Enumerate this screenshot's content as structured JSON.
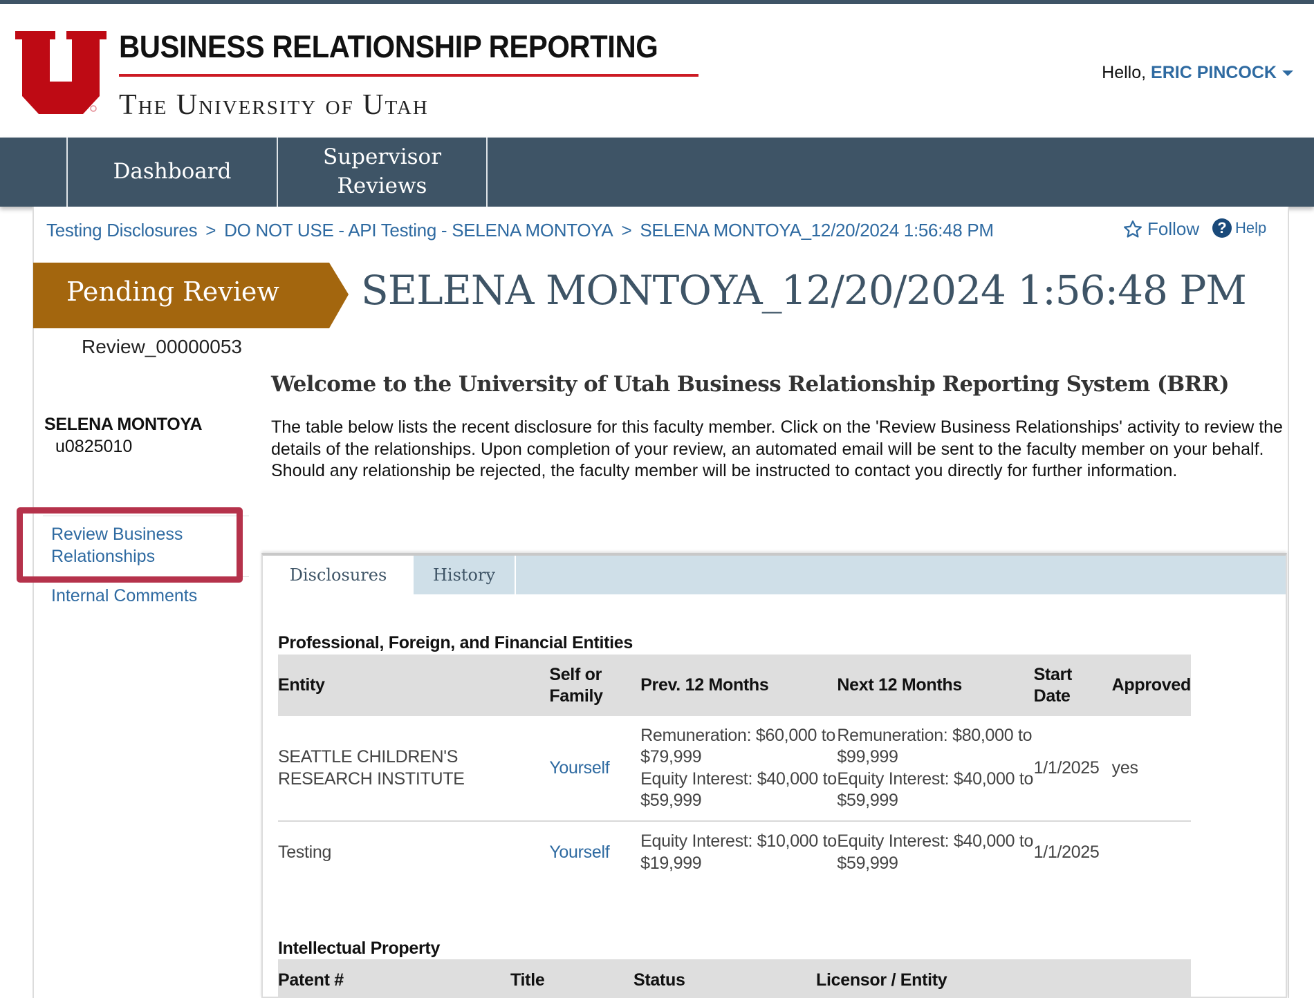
{
  "header": {
    "brand_title": "BUSINESS RELATIONSHIP REPORTING",
    "brand_subtitle": "The University of Utah",
    "greeting": "Hello,",
    "user_name": "ERIC PINCOCK",
    "colors": {
      "brand_red": "#cc1b24",
      "nav_bg": "#3e5466",
      "link": "#2e6aa1",
      "status_gold": "#a3660e",
      "highlight": "#b5324b"
    }
  },
  "nav": {
    "items": [
      {
        "label": "Dashboard"
      },
      {
        "label_line1": "Supervisor",
        "label_line2": "Reviews"
      }
    ]
  },
  "breadcrumb": {
    "items": [
      "Testing Disclosures",
      "DO NOT USE - API Testing - SELENA MONTOYA",
      "SELENA MONTOYA_12/20/2024 1:56:48 PM"
    ],
    "separator": ">"
  },
  "actions": {
    "follow": "Follow",
    "help": "Help",
    "follow_icon": "star-outline-icon",
    "help_icon": "question-circle-icon"
  },
  "status": {
    "label": "Pending Review",
    "review_id": "Review_00000053"
  },
  "page_title": "SELENA MONTOYA_12/20/2024 1:56:48 PM",
  "person": {
    "name": "SELENA MONTOYA",
    "uid": "u0825010"
  },
  "sidebar": {
    "links": [
      {
        "label_line1": "Review Business",
        "label_line2": "Relationships",
        "highlighted": true
      },
      {
        "label": "Internal Comments"
      }
    ]
  },
  "welcome": {
    "title": "Welcome to the University of Utah Business Relationship Reporting System (BRR)",
    "body": "The table below lists the recent disclosure for this faculty member. Click on the 'Review Business Relationships' activity to review the details of the relationships. Upon completion of your review, an automated email will be sent to the faculty member on your behalf. Should any relationship be rejected, the faculty member will be instructed to contact you directly for further information."
  },
  "tabs": [
    {
      "label": "Disclosures",
      "active": true
    },
    {
      "label": "History",
      "active": false
    }
  ],
  "entities_section": {
    "title": "Professional, Foreign, and Financial Entities",
    "columns": [
      "Entity",
      "Self or Family",
      "Prev. 12 Months",
      "Next 12 Months",
      "Start Date",
      "Approved"
    ],
    "rows": [
      {
        "entity": "SEATTLE CHILDREN'S RESEARCH INSTITUTE",
        "self_or_family": "Yourself",
        "prev_12": [
          "Remuneration: $60,000 to $79,999",
          "Equity Interest: $40,000 to $59,999"
        ],
        "next_12": [
          "Remuneration: $80,000 to $99,999",
          "Equity Interest: $40,000 to $59,999"
        ],
        "start_date": "1/1/2025",
        "approved": "yes"
      },
      {
        "entity": "Testing",
        "self_or_family": "Yourself",
        "prev_12": [
          "Equity Interest: $10,000 to $19,999"
        ],
        "next_12": [
          "Equity Interest: $40,000 to $59,999"
        ],
        "start_date": "1/1/2025",
        "approved": ""
      }
    ]
  },
  "ip_section": {
    "title": "Intellectual Property",
    "columns": [
      "Patent #",
      "Title",
      "Status",
      "Licensor / Entity"
    ]
  }
}
